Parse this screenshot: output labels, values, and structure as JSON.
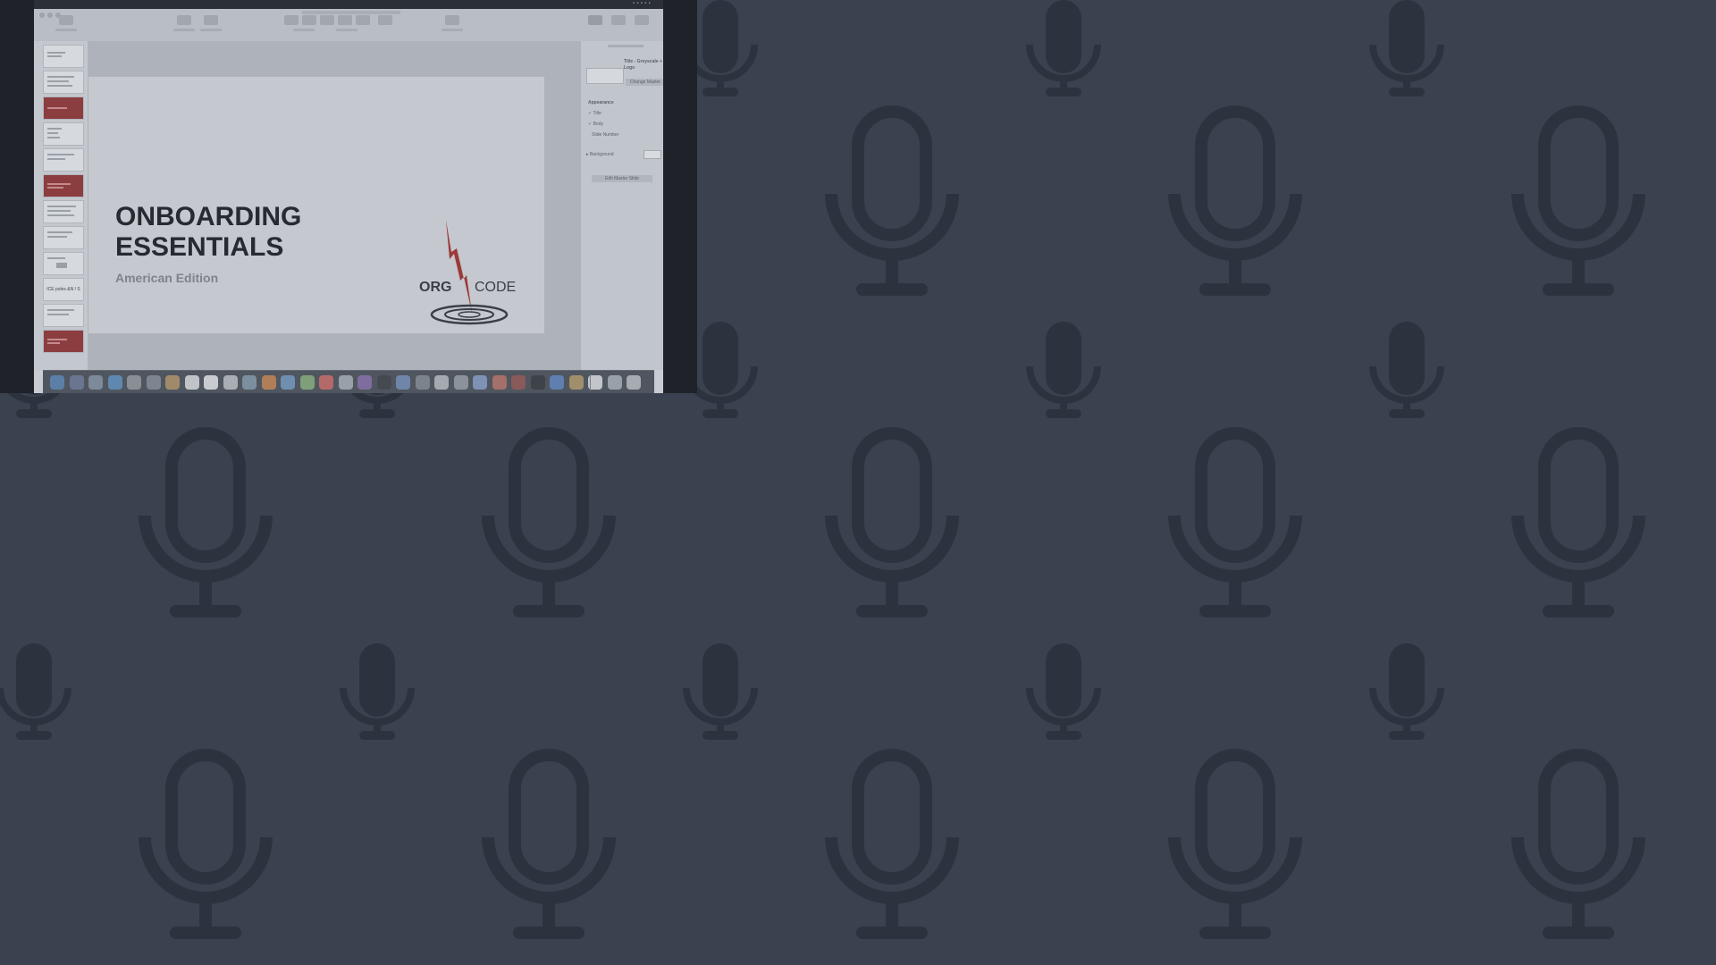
{
  "background": {
    "color": "#3a4250",
    "pattern_icon": "microphone-icon",
    "pattern_color": "#2d333e"
  },
  "shared_screen": {
    "app": "Keynote",
    "slide": {
      "title_line1": "ONBOARDING",
      "title_line2": "ESSENTIALS",
      "subtitle": "American Edition",
      "logo_left": "ORG",
      "logo_right": "CODE"
    },
    "inspector": {
      "master_name": "Title - Greyscale + Logo",
      "change_master": "Change Master",
      "appearance_heading": "Appearance",
      "options": [
        "Title",
        "Body",
        "Slide Number"
      ],
      "checked": [
        true,
        true,
        false
      ],
      "background_label": "Background",
      "edit_master": "Edit Master Slide"
    },
    "navigator_slide_text": "ICE poles &N / S"
  }
}
